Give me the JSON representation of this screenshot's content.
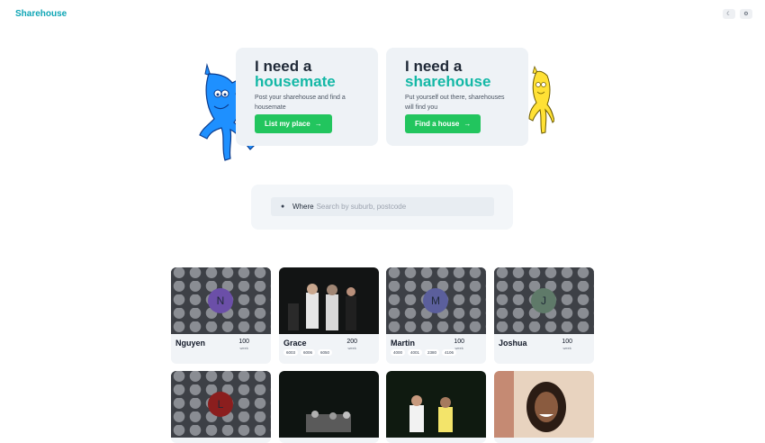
{
  "header": {
    "logo": "Sharehouse",
    "theme_icon": "moon-icon",
    "settings_icon": "gear-icon"
  },
  "hero": {
    "left": {
      "line1": "I need a",
      "line2": "housemate",
      "description": "Post your sharehouse and find a housemate",
      "button": "List my place"
    },
    "right": {
      "line1": "I need a",
      "line2": "sharehouse",
      "description": "Put yourself out there, sharehouses will find you",
      "button": "Find a house"
    }
  },
  "search": {
    "label": "Where",
    "placeholder": "Search by suburb, postcode"
  },
  "listings": [
    {
      "name": "Nguyen",
      "price": "100",
      "per": "week",
      "initial": "N",
      "avatar_color": "#6b4fa8",
      "tags": []
    },
    {
      "name": "Grace",
      "price": "200",
      "per": "week",
      "initial": "",
      "tags": [
        "6003",
        "6006",
        "6050"
      ]
    },
    {
      "name": "Martin",
      "price": "100",
      "per": "week",
      "initial": "M",
      "avatar_color": "#5b5f9c",
      "tags": [
        "4000",
        "4001",
        "2380",
        "4106"
      ]
    },
    {
      "name": "Joshua",
      "price": "100",
      "per": "week",
      "initial": "J",
      "avatar_color": "#5f7a69",
      "tags": []
    },
    {
      "name": "",
      "initial": "L",
      "avatar_color": "#8b1e1e"
    }
  ],
  "colors": {
    "accent": "#14b8a6",
    "button": "#22c55e",
    "logo": "#0ea5b5"
  }
}
